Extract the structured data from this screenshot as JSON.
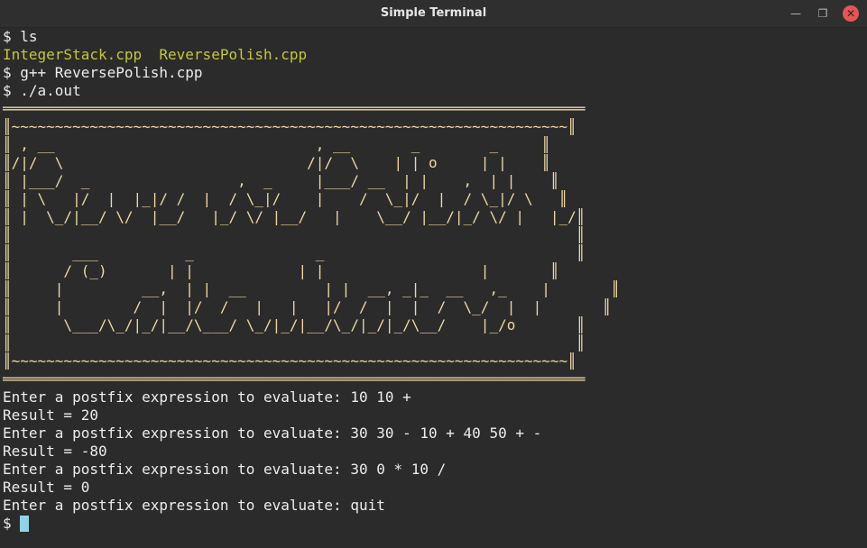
{
  "window": {
    "title": "Simple Terminal",
    "min_glyph": "—",
    "max_glyph": "❐",
    "close_glyph": "✕"
  },
  "terminal": {
    "cmd_ls": "$ ls",
    "file1": "IntegerStack.cpp",
    "file2": "ReversePolish.cpp",
    "cmd_compile": "$ g++ ReversePolish.cpp",
    "cmd_run": "$ ./a.out",
    "banner": [
      "═══════════════════════════════════════════════════════════════════",
      "║~~~~~~~~~~~~~~~~~~~~~~~~~~~~~~~~~~~~~~~~~~~~~~~~~~~~~~~~~~~~~~~~║",
      "║ , __                              , __       _        _     ║",
      "║/|/  \\                            /|/  \\    | | o     | |    ║",
      "║ |___/  _                 ,  _     |___/ __  | |    ,  | |    ║",
      "║ | \\   |/  |  |_|/ /  |  / \\_|/    |    /  \\_|/  |  / \\_|/ \\   ║",
      "║ |  \\_/|__/ \\/  |__/   |_/ \\/ |__/   |    \\__/ |__/|_/ \\/ |   |_/║",
      "║                                                                 ║",
      "║       ___          _              _                             ║",
      "║      / (_)       | |            | |                  |       ║",
      "║     |         __,  | |  __         | |  __, _|_  __   ,_    |       ║",
      "║     |        /  |  |/  /   |   |   |/  /  |  |  /  \\_/  |  |       ║",
      "║      \\___/\\_/|_/|__/\\___/ \\_/|_/|__/\\_/|_/|_/\\__/    |_/o       ║",
      "║                                                                 ║",
      "║~~~~~~~~~~~~~~~~~~~~~~~~~~~~~~~~~~~~~~~~~~~~~~~~~~~~~~~~~~~~~~~~║",
      "═══════════════════════════════════════════════════════════════════"
    ],
    "session": [
      "Enter a postfix expression to evaluate: 10 10 +",
      "Result = 20",
      "Enter a postfix expression to evaluate: 30 30 - 10 + 40 50 + -",
      "Result = -80",
      "Enter a postfix expression to evaluate: 30 0 * 10 /",
      "Result = 0",
      "Enter a postfix expression to evaluate: quit"
    ],
    "prompt": "$"
  },
  "colors": {
    "background": "#2b2b2b",
    "text": "#ececec",
    "executable": "#c6c63a",
    "banner": "#eed7a3",
    "cursor": "#8fd4e6",
    "close_button": "#e25656"
  }
}
